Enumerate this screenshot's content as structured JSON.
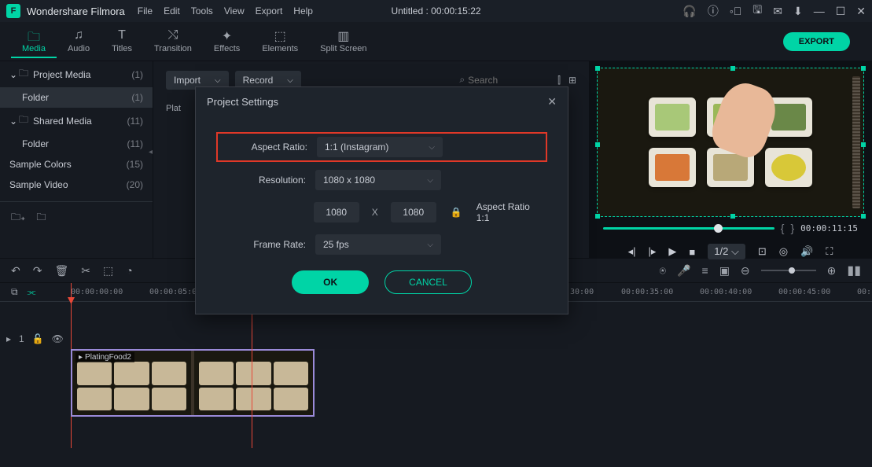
{
  "app": {
    "name": "Wondershare Filmora",
    "title_center": "Untitled : 00:00:15:22"
  },
  "menu": {
    "file": "File",
    "edit": "Edit",
    "tools": "Tools",
    "view": "View",
    "export": "Export",
    "help": "Help"
  },
  "tabs": {
    "media": "Media",
    "audio": "Audio",
    "titles": "Titles",
    "transition": "Transition",
    "effects": "Effects",
    "elements": "Elements",
    "split_screen": "Split Screen"
  },
  "export_btn": "EXPORT",
  "sidebar": {
    "project_media": {
      "label": "Project Media",
      "count": "(1)"
    },
    "folder1": {
      "label": "Folder",
      "count": "(1)"
    },
    "shared_media": {
      "label": "Shared Media",
      "count": "(11)"
    },
    "folder2": {
      "label": "Folder",
      "count": "(11)"
    },
    "sample_colors": {
      "label": "Sample Colors",
      "count": "(15)"
    },
    "sample_video": {
      "label": "Sample Video",
      "count": "(20)"
    }
  },
  "center": {
    "import": "Import",
    "record": "Record",
    "search_ph": "Search",
    "thumb_label": "Plat"
  },
  "preview": {
    "timecode": "00:00:11:15",
    "scale": "1/2"
  },
  "dialog": {
    "title": "Project Settings",
    "aspect_ratio_label": "Aspect Ratio:",
    "aspect_ratio_value": "1:1 (Instagram)",
    "resolution_label": "Resolution:",
    "resolution_value": "1080 x 1080",
    "width": "1080",
    "x": "X",
    "height": "1080",
    "ar_text": "Aspect Ratio 1:1",
    "frame_rate_label": "Frame Rate:",
    "frame_rate_value": "25 fps",
    "ok": "OK",
    "cancel": "CANCEL"
  },
  "ruler": {
    "t0": "00:00:00:00",
    "t1": "00:00:05:00",
    "t2": "30:00",
    "t3": "00:00:35:00",
    "t4": "00:00:40:00",
    "t5": "00:00:45:00",
    "t6": "00:"
  },
  "clip": {
    "name": "PlatingFood2"
  },
  "track": {
    "label": "1"
  }
}
